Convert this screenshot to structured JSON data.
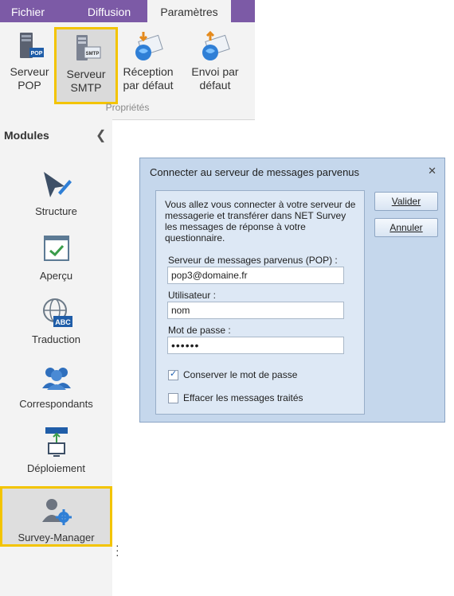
{
  "ribbon": {
    "tabs": [
      {
        "label": "Fichier"
      },
      {
        "label": "Diffusion"
      },
      {
        "label": "Paramètres"
      }
    ],
    "buttons": [
      {
        "label": "Serveur\nPOP",
        "icon": "pop-server-icon"
      },
      {
        "label": "Serveur\nSMTP",
        "icon": "smtp-server-icon"
      },
      {
        "label": "Réception\npar défaut",
        "icon": "mail-receive-icon"
      },
      {
        "label": "Envoi par\ndéfaut",
        "icon": "mail-send-icon"
      }
    ],
    "group_label": "Propriétés"
  },
  "sidebar": {
    "title": "Modules",
    "modules": [
      {
        "label": "Structure",
        "icon": "structure-pen-icon"
      },
      {
        "label": "Aperçu",
        "icon": "preview-window-icon"
      },
      {
        "label": "Traduction",
        "icon": "globe-abc-icon"
      },
      {
        "label": "Correspondants",
        "icon": "contacts-people-icon"
      },
      {
        "label": "Déploiement",
        "icon": "deploy-network-icon"
      },
      {
        "label": "Survey-Manager",
        "icon": "user-gear-icon"
      }
    ]
  },
  "dialog": {
    "title": "Connecter au serveur de messages parvenus",
    "intro": "Vous allez vous connecter à votre serveur de messagerie et transférer dans NET Survey les messages de réponse à votre questionnaire.",
    "server_label": "Serveur de messages parvenus (POP) :",
    "server_value": "pop3@domaine.fr",
    "user_label": "Utilisateur :",
    "user_value": "nom",
    "password_label": "Mot de passe :",
    "password_value": "••••••",
    "keep_password_label": "Conserver le mot de passe",
    "keep_password_checked": true,
    "delete_processed_label": "Effacer les messages traités",
    "delete_processed_checked": false,
    "validate_label": "Valider",
    "cancel_label": "Annuler"
  },
  "colors": {
    "ribbon_tab_bar": "#7c5aa6",
    "highlight_border": "#f3c400",
    "dialog_background": "#c5d7ec"
  }
}
